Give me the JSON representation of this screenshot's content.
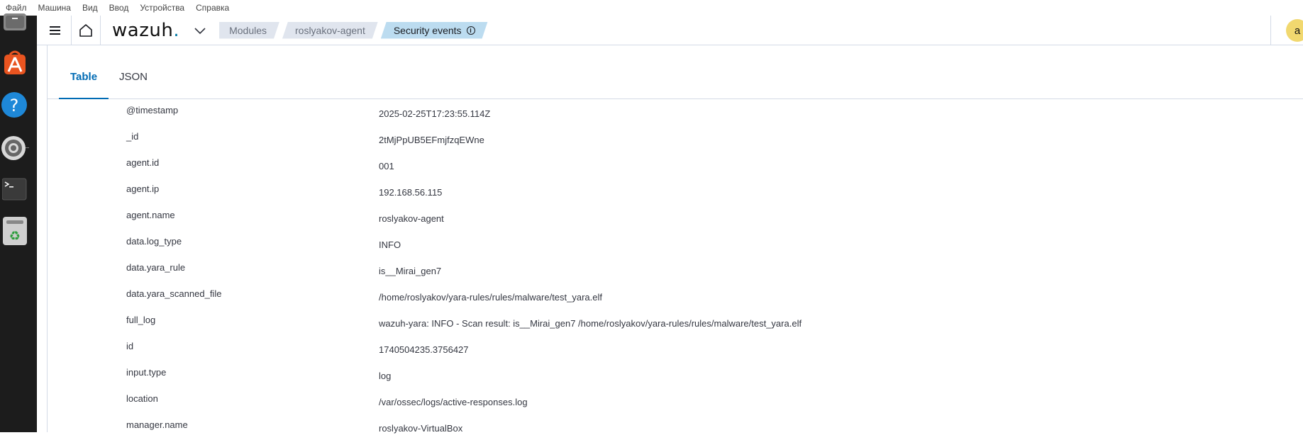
{
  "vm_menu": [
    "Файл",
    "Машина",
    "Вид",
    "Ввод",
    "Устройства",
    "Справка"
  ],
  "dock": {
    "items": [
      {
        "name": "files"
      },
      {
        "name": "app-center"
      },
      {
        "name": "help"
      },
      {
        "name": "settings"
      },
      {
        "name": "terminal"
      },
      {
        "name": "trash"
      }
    ]
  },
  "header": {
    "logo_text": "wazuh",
    "logo_dot": ".",
    "breadcrumbs": [
      "Modules",
      "roslyakov-agent",
      "Security events"
    ],
    "info_glyph": "i",
    "avatar_letter": "a"
  },
  "tabs": [
    {
      "label": "Table",
      "active": true
    },
    {
      "label": "JSON",
      "active": false
    }
  ],
  "document": [
    {
      "key": "@timestamp",
      "value": "2025-02-25T17:23:55.114Z"
    },
    {
      "key": "_id",
      "value": "2tMjPpUB5EFmjfzqEWne"
    },
    {
      "key": "agent.id",
      "value": "001"
    },
    {
      "key": "agent.ip",
      "value": "192.168.56.115"
    },
    {
      "key": "agent.name",
      "value": "roslyakov-agent"
    },
    {
      "key": "data.log_type",
      "value": "INFO"
    },
    {
      "key": "data.yara_rule",
      "value": "is__Mirai_gen7"
    },
    {
      "key": "data.yara_scanned_file",
      "value": "/home/roslyakov/yara-rules/rules/malware/test_yara.elf"
    },
    {
      "key": "full_log",
      "value": "wazuh-yara: INFO - Scan result: is__Mirai_gen7 /home/roslyakov/yara-rules/rules/malware/test_yara.elf"
    },
    {
      "key": "id",
      "value": "1740504235.3756427"
    },
    {
      "key": "input.type",
      "value": "log"
    },
    {
      "key": "location",
      "value": "/var/ossec/logs/active-responses.log"
    },
    {
      "key": "manager.name",
      "value": "roslyakov-VirtualBox"
    }
  ],
  "colors": {
    "accent": "#006bb4",
    "dock_bg": "#1c1c1c",
    "breadcrumb_active": "#bcdcf0",
    "avatar": "#f1d86f"
  }
}
